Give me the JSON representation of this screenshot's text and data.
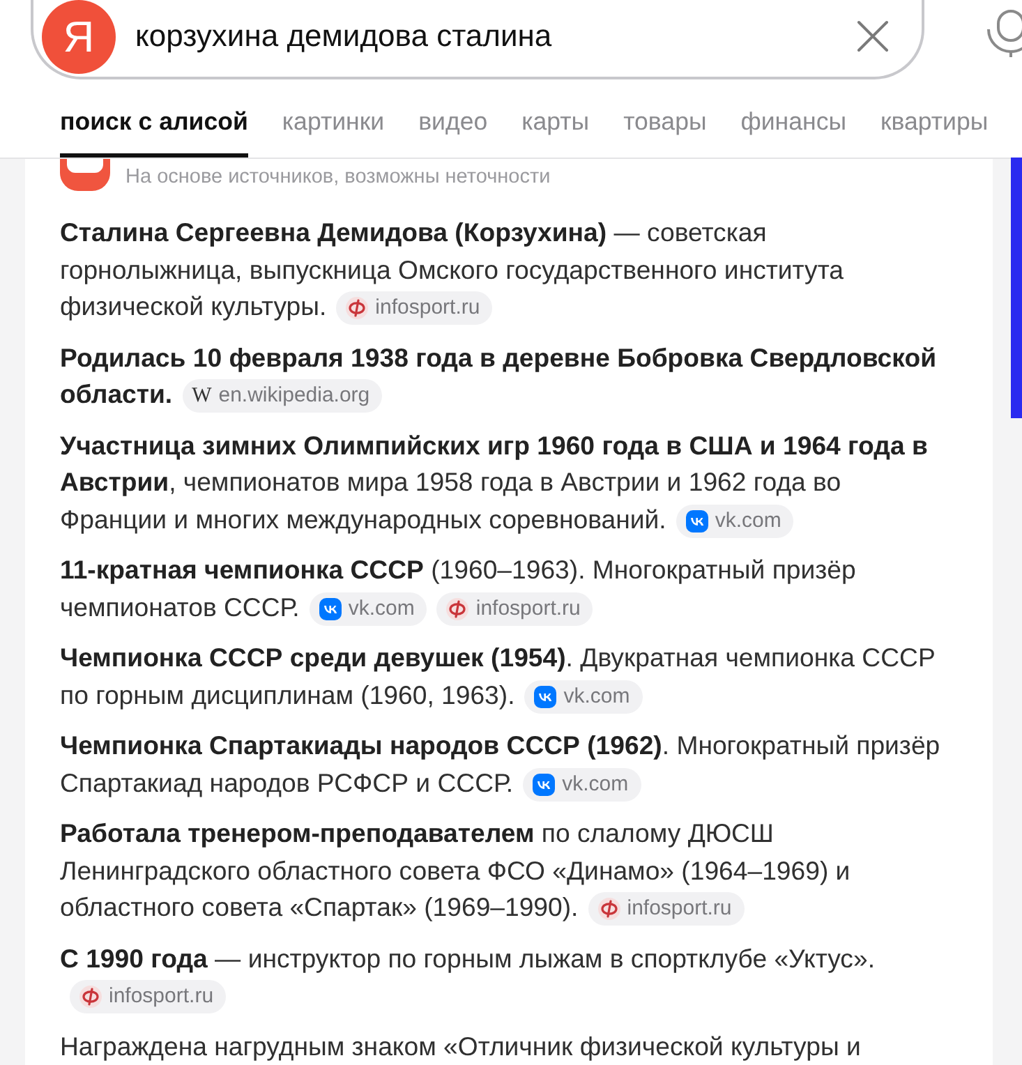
{
  "search": {
    "logo": "Я",
    "query": "корзухина демидова сталина"
  },
  "tabs": [
    {
      "label": "поиск с алисой",
      "selected": true
    },
    {
      "label": "картинки",
      "selected": false
    },
    {
      "label": "видео",
      "selected": false
    },
    {
      "label": "карты",
      "selected": false
    },
    {
      "label": "товары",
      "selected": false
    },
    {
      "label": "финансы",
      "selected": false
    },
    {
      "label": "квартиры",
      "selected": false
    }
  ],
  "answer": {
    "disclaimer": "На основе источников, возможны неточности",
    "facts": [
      {
        "text": "**Сталина Сергеевна Демидова (Корзухина)** — советская горнолыжница, выпускница Омского государственного института физической культуры.",
        "bold": false,
        "sources": [
          {
            "kind": "infosport",
            "label": "infosport.ru"
          }
        ]
      },
      {
        "text": "Родилась 10 февраля 1938 года в деревне Бобровка Свердловской области.",
        "bold": true,
        "sources": [
          {
            "kind": "glyph",
            "glyph": "W",
            "label": "en.wikipedia.org"
          }
        ]
      },
      {
        "text": "**Участница зимних Олимпийских игр 1960 года в США и 1964 года в Австрии**, чемпионатов мира 1958 года в Австрии и 1962 года во Франции и многих международных соревнований.",
        "bold": false,
        "sources": [
          {
            "kind": "vk",
            "label": "vk.com"
          }
        ]
      },
      {
        "text": "**11-кратная чемпионка СССР** (1960–1963). Многократный призёр чемпионатов СССР.",
        "bold": false,
        "sources": [
          {
            "kind": "vk",
            "label": "vk.com"
          },
          {
            "kind": "infosport",
            "label": "infosport.ru"
          }
        ]
      },
      {
        "text": "**Чемпионка СССР среди девушек (1954)**. Двукратная чемпионка СССР по горным дисциплинам (1960, 1963).",
        "bold": false,
        "sources": [
          {
            "kind": "vk",
            "label": "vk.com"
          }
        ]
      },
      {
        "text": "**Чемпионка Спартакиады народов СССР (1962)**. Многократный призёр Спартакиад народов РСФСР и СССР.",
        "bold": false,
        "sources": [
          {
            "kind": "vk",
            "label": "vk.com"
          }
        ]
      },
      {
        "text": "**Работала тренером-преподавателем** по слалому ДЮСШ Ленинградского областного совета ФСО «Динамо» (1964–1969) и областного совета «Спартак» (1969–1990).",
        "bold": false,
        "sources": [
          {
            "kind": "infosport",
            "label": "infosport.ru"
          }
        ]
      },
      {
        "text": "**С 1990 года** — инструктор по горным лыжам в спортклубе «Уктус».",
        "bold": false,
        "sources": [
          {
            "kind": "infosport",
            "label": "infosport.ru"
          }
        ]
      },
      {
        "text": "Награждена нагрудным знаком «Отличник физической культуры и",
        "bold": false
      }
    ]
  }
}
